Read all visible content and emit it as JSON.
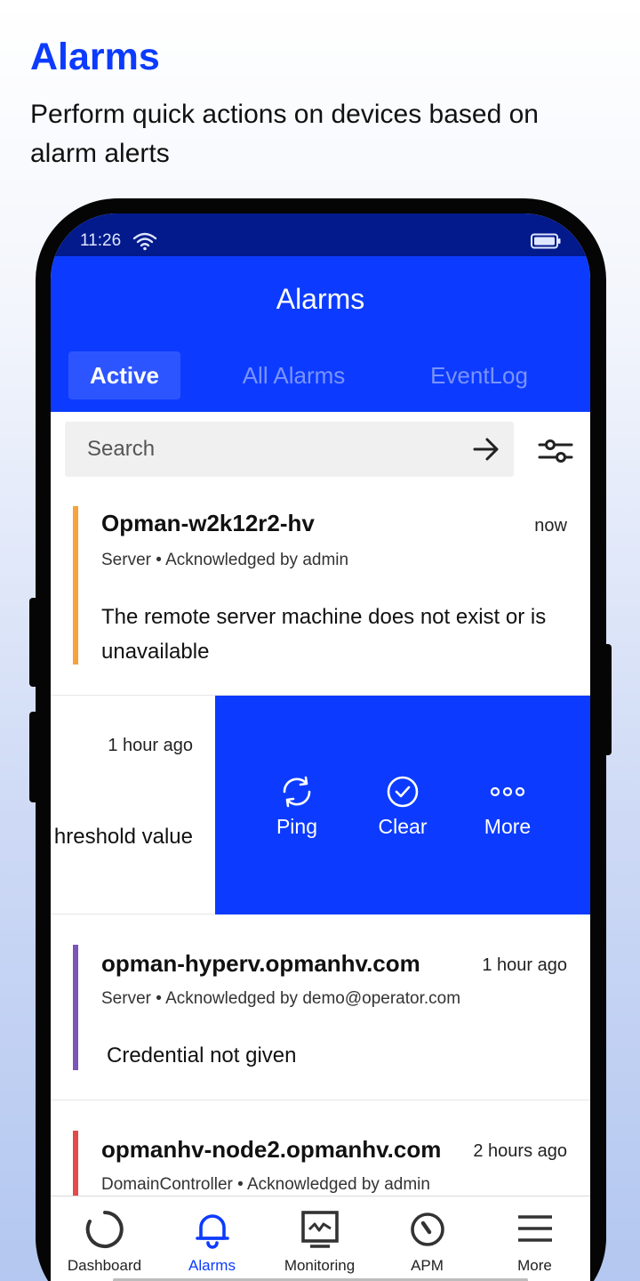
{
  "promo": {
    "title": "Alarms",
    "subtitle": "Perform quick actions on devices based on alarm alerts"
  },
  "status_bar": {
    "time": "11:26",
    "icons": [
      "wifi-icon",
      "battery-icon"
    ]
  },
  "header": {
    "title": "Alarms",
    "tabs": [
      {
        "label": "Active",
        "active": true
      },
      {
        "label": "All Alarms",
        "active": false
      },
      {
        "label": "EventLog",
        "active": false
      }
    ]
  },
  "search": {
    "placeholder": "Search"
  },
  "alarms": [
    {
      "name": "Opman-w2k12r2-hv",
      "time": "now",
      "meta": "Server • Acknowledged by admin",
      "message": "The remote server machine does not exist or is unavailable",
      "severity_color": "#f7a23a"
    },
    {
      "time": "1 hour ago",
      "message_fragment": "hreshold value"
    },
    {
      "name": "opman-hyperv.opmanhv.com",
      "time": "1 hour ago",
      "meta": "Server • Acknowledged by demo@operator.com",
      "message": "Credential not given",
      "severity_color": "#7b55b8"
    },
    {
      "name": "opmanhv-node2.opmanhv.com",
      "time": "2 hours ago",
      "meta": "DomainController • Acknowledged by admin",
      "severity_color": "#e34a4a"
    }
  ],
  "swipe_actions": [
    {
      "label": "Ping",
      "icon": "ping-icon"
    },
    {
      "label": "Clear",
      "icon": "clear-icon"
    },
    {
      "label": "More",
      "icon": "more-icon"
    }
  ],
  "bottom_nav": [
    {
      "label": "Dashboard",
      "icon": "dashboard-icon",
      "active": false
    },
    {
      "label": "Alarms",
      "icon": "bell-icon",
      "active": true
    },
    {
      "label": "Monitoring",
      "icon": "monitoring-icon",
      "active": false
    },
    {
      "label": "APM",
      "icon": "apm-icon",
      "active": false
    },
    {
      "label": "More",
      "icon": "menu-icon",
      "active": false
    }
  ],
  "colors": {
    "brand": "#0c3bff",
    "status_bar": "#031a8c",
    "tab_active_bg": "#2d55ff",
    "tab_inactive_text": "#7a93ff"
  }
}
